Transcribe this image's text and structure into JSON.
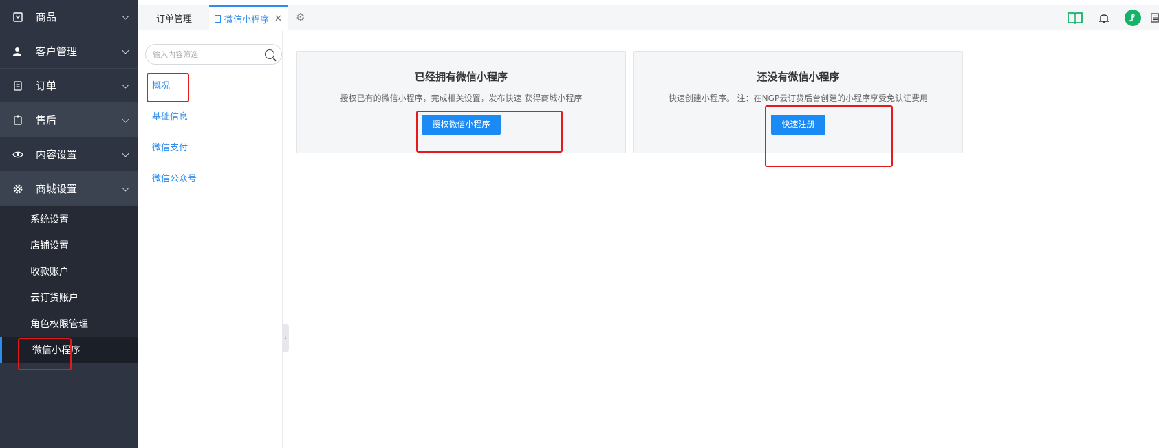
{
  "sidebar": {
    "items": [
      {
        "label": "商品",
        "icon": "product-icon"
      },
      {
        "label": "客户管理",
        "icon": "user-icon"
      },
      {
        "label": "订单",
        "icon": "list-icon"
      },
      {
        "label": "售后",
        "icon": "clipboard-icon"
      },
      {
        "label": "内容设置",
        "icon": "eye-icon"
      },
      {
        "label": "商城设置",
        "icon": "gear-icon"
      }
    ],
    "submenu": [
      {
        "label": "系统设置"
      },
      {
        "label": "店铺设置"
      },
      {
        "label": "收款账户"
      },
      {
        "label": "云订货账户"
      },
      {
        "label": "角色权限管理"
      },
      {
        "label": "微信小程序"
      }
    ]
  },
  "tabs": {
    "tab1": "订单管理",
    "tab2": "微信小程序",
    "close": "✕"
  },
  "subnav": {
    "search_placeholder": "输入内容筛选",
    "items": [
      "概况",
      "基础信息",
      "微信支付",
      "微信公众号"
    ]
  },
  "cards": [
    {
      "title": "已经拥有微信小程序",
      "desc": "授权已有的微信小程序，完成相关设置，发布快速 获得商城小程序",
      "button": "授权微信小程序"
    },
    {
      "title": "还没有微信小程序",
      "desc": "快速创建小程序。 注：在NGP云订货后台创建的小程序享受免认证费用",
      "button": "快速注册"
    }
  ],
  "colors": {
    "accent": "#2d8cf0",
    "sidebar_bg": "#2e3441",
    "annotation": "#e61a1a",
    "green": "#17b26a"
  }
}
